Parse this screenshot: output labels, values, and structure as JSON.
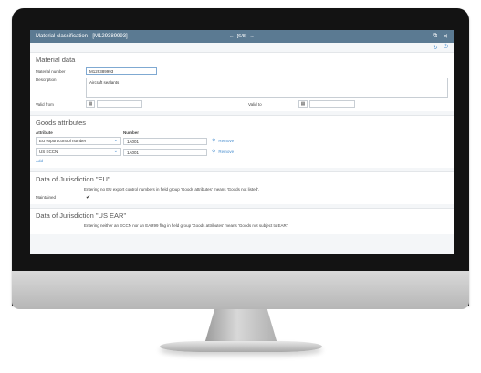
{
  "window": {
    "title": "Material classification - [M129389993]",
    "nav_prev": "←",
    "nav_position": "[6/8]",
    "nav_next": "→",
    "popout_icon": "popout-icon",
    "close_icon": "close-icon"
  },
  "toolbar": {
    "refresh_icon": "refresh-icon",
    "power_icon": "power-icon"
  },
  "material_data": {
    "heading": "Material data",
    "material_number_label": "Material number",
    "material_number_value": "M129389993",
    "description_label": "Description",
    "description_value": "Aircraft sealants",
    "valid_from_label": "Valid from",
    "valid_from_value": "",
    "valid_to_label": "Valid to",
    "valid_to_value": ""
  },
  "goods_attributes": {
    "heading": "Goods attributes",
    "col_attribute": "Attribute",
    "col_number": "Number",
    "rows": [
      {
        "attribute": "EU export control number",
        "number": "1A001",
        "remove": "Remove"
      },
      {
        "attribute": "US ECCN",
        "number": "1A001",
        "remove": "Remove"
      }
    ],
    "add_label": "Add"
  },
  "jurisdiction_eu": {
    "heading": "Data of Jurisdiction \"EU\"",
    "note": "Entering no EU export control numbers in field group 'Goods attributes' means 'Goods not listed'.",
    "maintained_label": "Maintained",
    "maintained_checked": true
  },
  "jurisdiction_us": {
    "heading": "Data of Jurisdiction \"US EAR\"",
    "note": "Entering neither an ECCN nor an EAR99 flag in field group 'Goods attributes' means 'Goods not subject to EAR'."
  },
  "colors": {
    "titlebar": "#5b7a92",
    "accent": "#4a8fcf",
    "bezel": "#131313"
  }
}
